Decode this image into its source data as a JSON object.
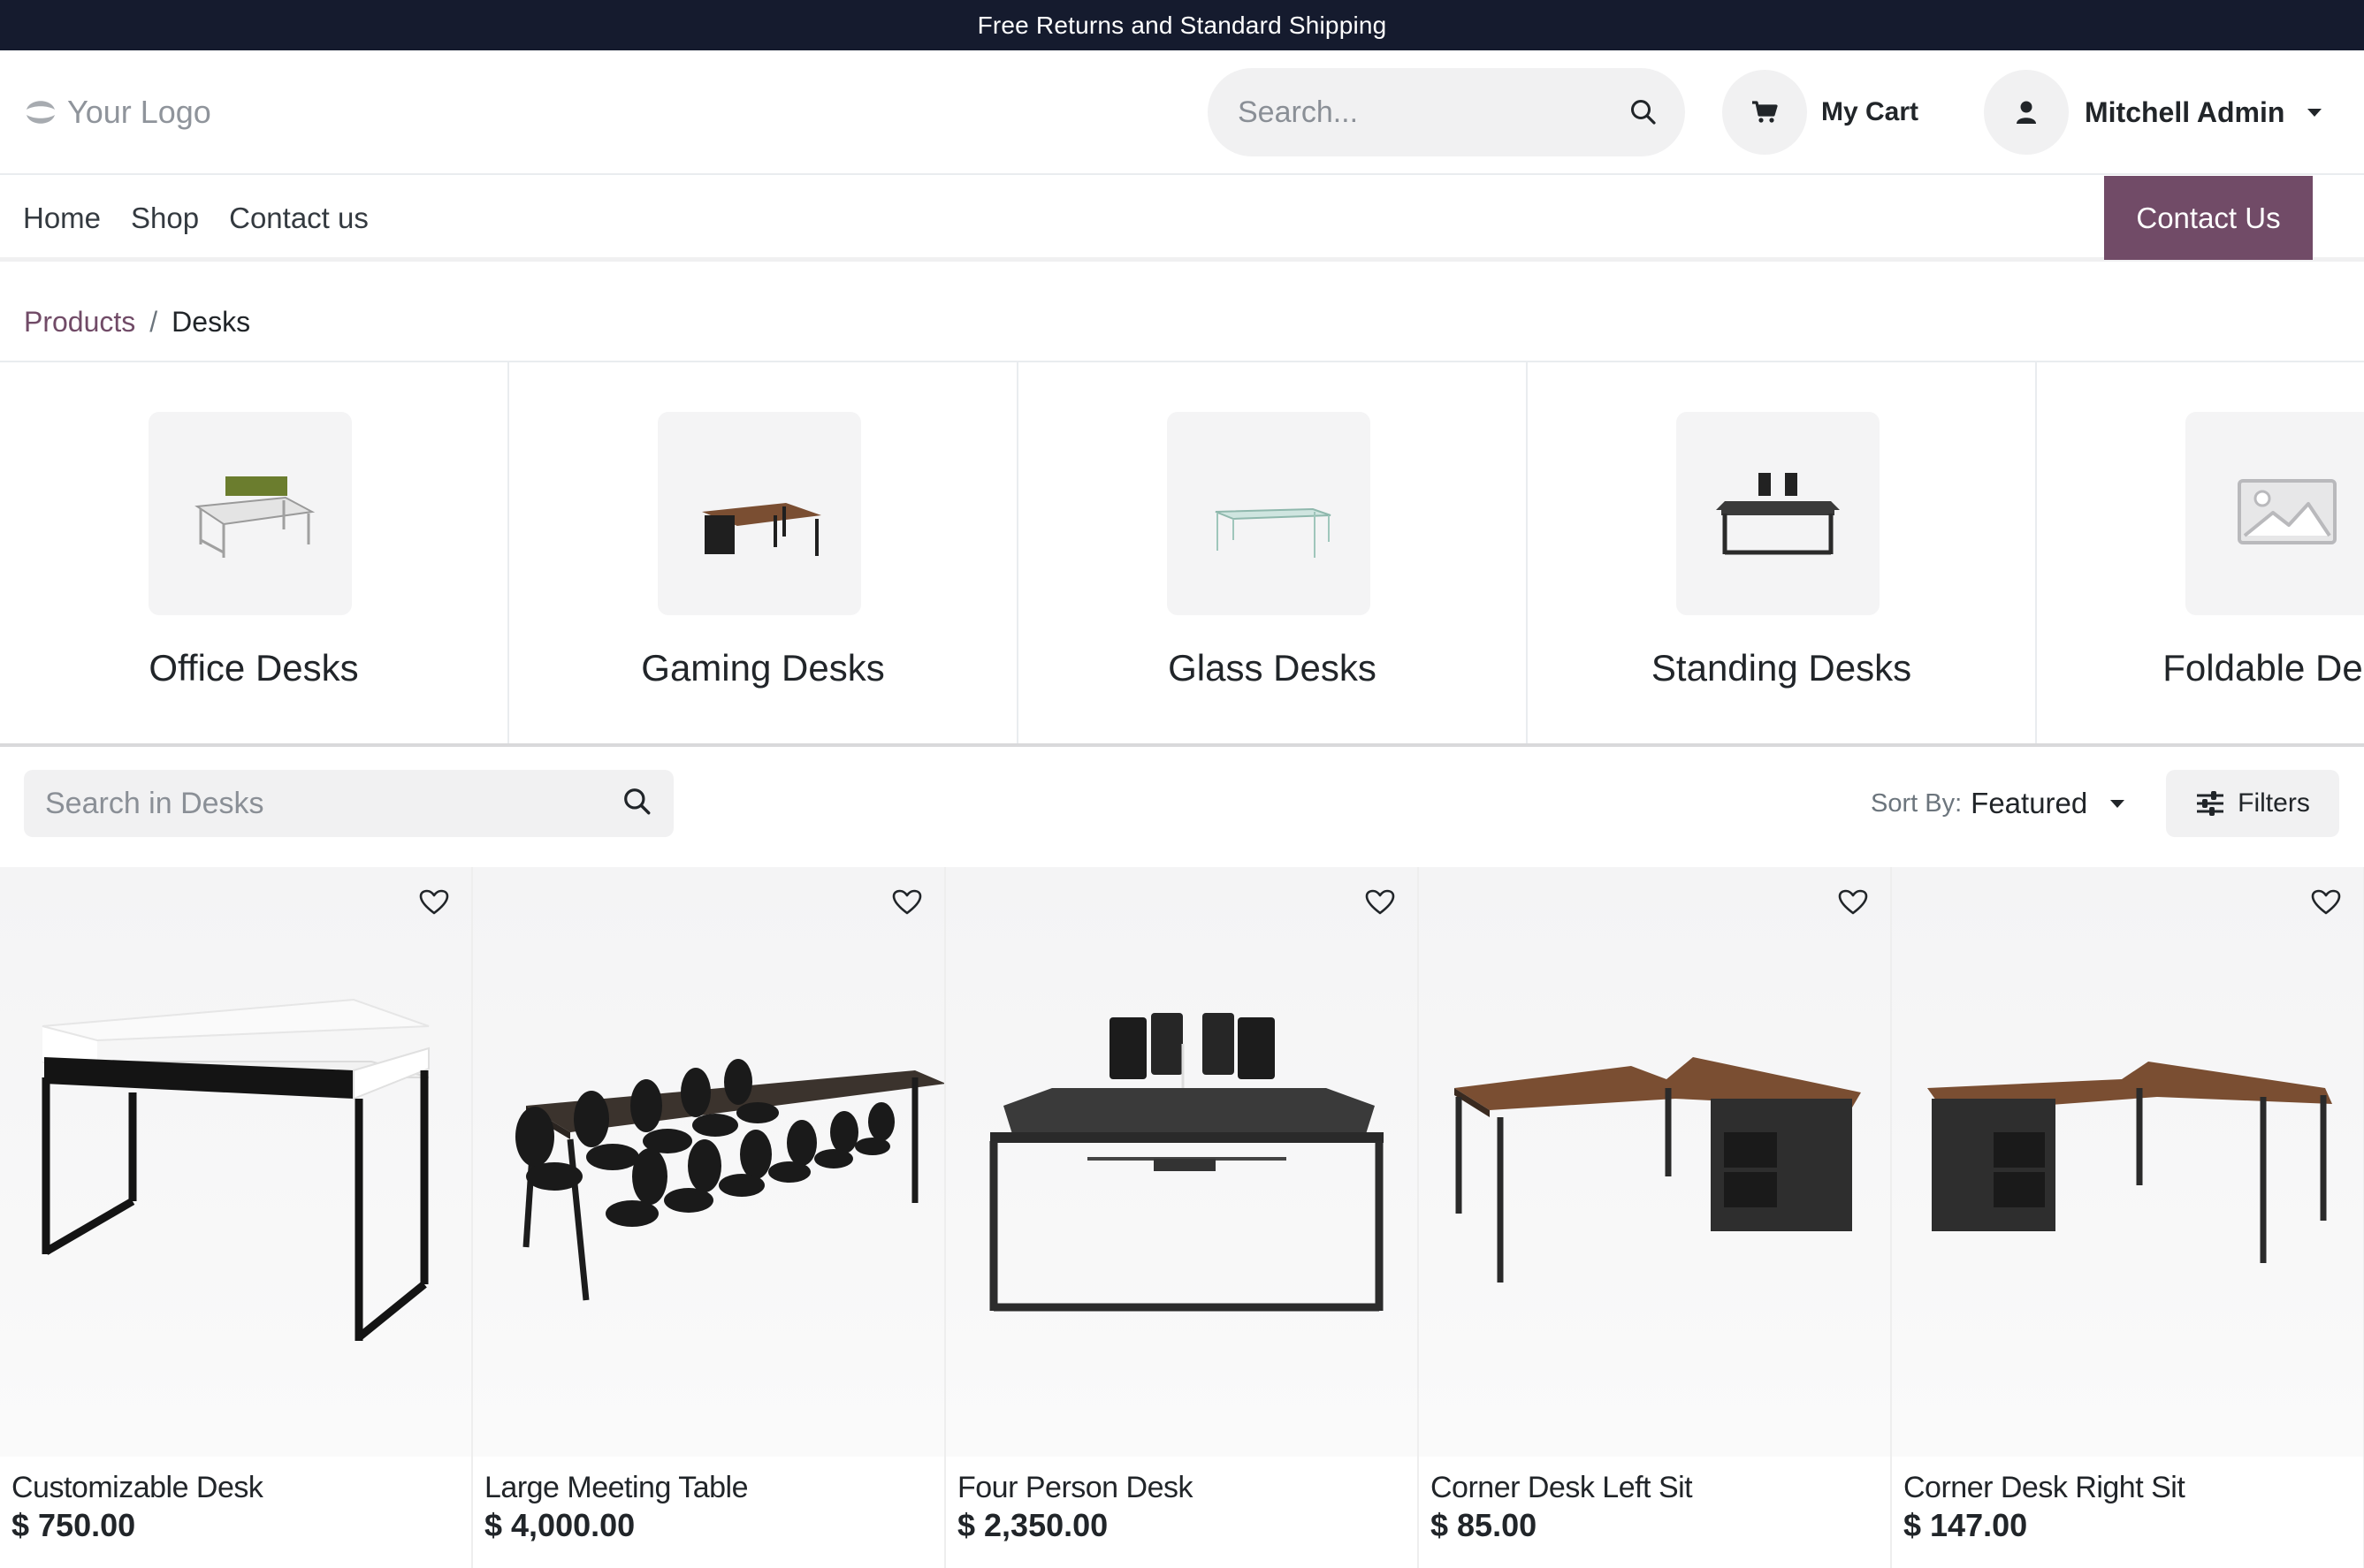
{
  "announcement": "Free Returns and Standard Shipping",
  "header": {
    "logo_text": "Your Logo",
    "search_placeholder": "Search...",
    "cart_label": "My Cart",
    "user_name": "Mitchell Admin"
  },
  "nav": {
    "links": [
      "Home",
      "Shop",
      "Contact us"
    ],
    "cta": "Contact Us"
  },
  "breadcrumb": {
    "parent": "Products",
    "separator": "/",
    "current": "Desks"
  },
  "categories": [
    {
      "name": "Office Desks",
      "icon": "office-desk-image"
    },
    {
      "name": "Gaming Desks",
      "icon": "gaming-desk-image"
    },
    {
      "name": "Glass Desks",
      "icon": "glass-desk-image"
    },
    {
      "name": "Standing Desks",
      "icon": "standing-desk-image"
    },
    {
      "name": "Foldable Desks",
      "icon": "placeholder-image"
    }
  ],
  "toolbar": {
    "search_placeholder": "Search in Desks",
    "sort_label": "Sort By:",
    "sort_value": "Featured",
    "filters_label": "Filters"
  },
  "products": [
    {
      "name": "Customizable Desk",
      "price": "$ 750.00"
    },
    {
      "name": "Large Meeting Table",
      "price": "$ 4,000.00"
    },
    {
      "name": "Four Person Desk",
      "price": "$ 2,350.00"
    },
    {
      "name": "Corner Desk Left Sit",
      "price": "$ 85.00"
    },
    {
      "name": "Corner Desk Right Sit",
      "price": "$ 147.00"
    }
  ],
  "colors": {
    "announcement_bg": "#151b2e",
    "brand": "#714b67"
  }
}
